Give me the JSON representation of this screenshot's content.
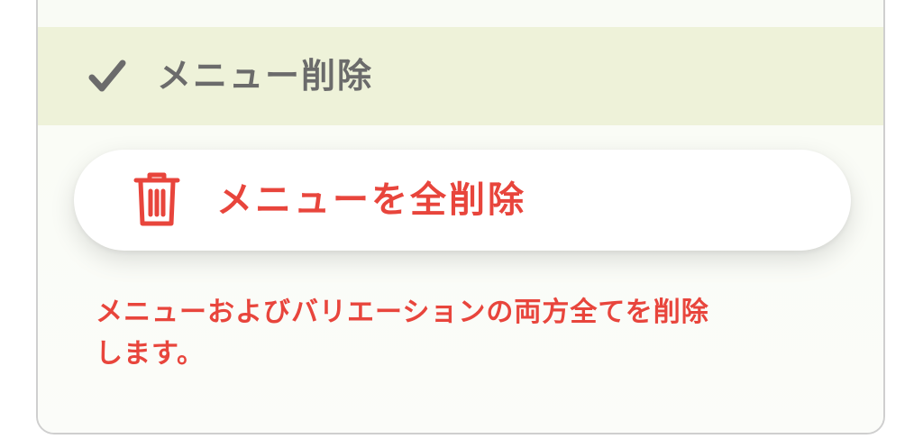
{
  "colors": {
    "header_bg": "#eef2d9",
    "header_text": "#6b6b6b",
    "danger": "#e8453c",
    "card_border": "#cfcfcf",
    "button_bg": "#ffffff"
  },
  "section": {
    "check_icon": "checkmark-icon",
    "title": "メニュー削除"
  },
  "delete_all_button": {
    "icon": "trash-icon",
    "label": "メニューを全削除"
  },
  "description": {
    "line1": "メニューおよびバリエーションの両方全てを削除",
    "line2": "します。"
  }
}
